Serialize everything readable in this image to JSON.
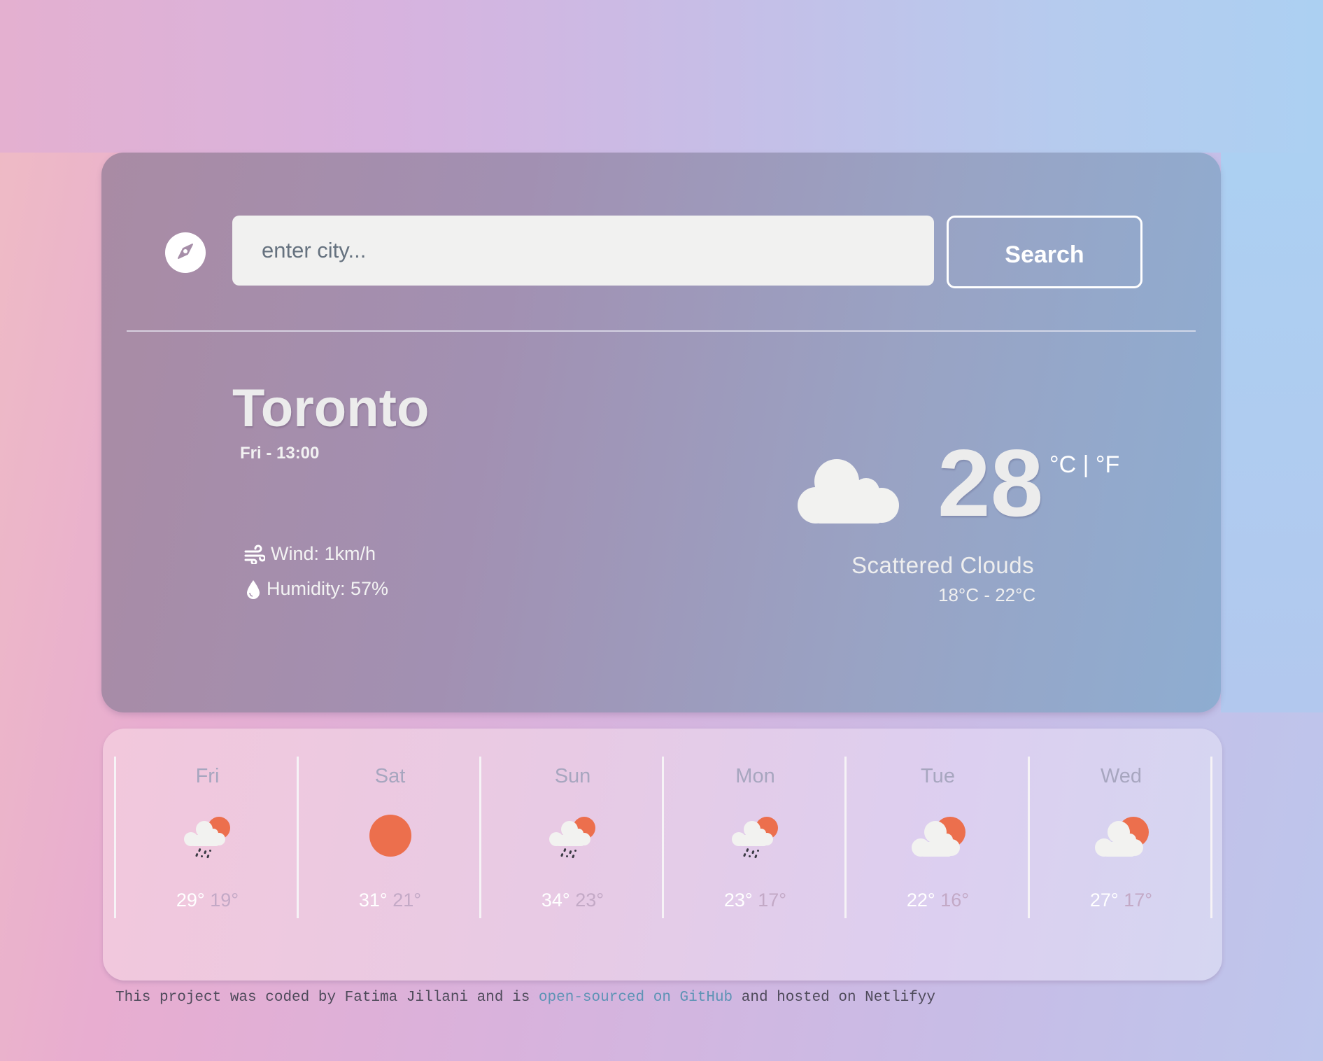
{
  "search": {
    "placeholder": "enter city...",
    "value": "",
    "button_label": "Search",
    "location_icon": "compass-icon"
  },
  "current": {
    "city": "Toronto",
    "datetime": "Fri - 13:00",
    "wind_label": "Wind: 1km/h",
    "wind_icon": "wind-icon",
    "humidity_label": "Humidity: 57%",
    "humidity_icon": "droplet-icon",
    "weather_icon": "cloud-icon",
    "temperature": "28",
    "unit_celsius": "°C",
    "unit_separator": "|",
    "unit_fahrenheit": "°F",
    "description": "Scattered Clouds",
    "range": "18°C - 22°C"
  },
  "forecast": [
    {
      "day": "Fri",
      "icon": "rain-cloud-sun-icon",
      "high": "29°",
      "low": "19°"
    },
    {
      "day": "Sat",
      "icon": "sun-icon",
      "high": "31°",
      "low": "21°"
    },
    {
      "day": "Sun",
      "icon": "rain-cloud-sun-icon",
      "high": "34°",
      "low": "23°"
    },
    {
      "day": "Mon",
      "icon": "rain-cloud-sun-icon",
      "high": "23°",
      "low": "17°"
    },
    {
      "day": "Tue",
      "icon": "cloud-sun-icon",
      "high": "22°",
      "low": "16°"
    },
    {
      "day": "Wed",
      "icon": "cloud-sun-icon",
      "high": "27°",
      "low": "17°"
    }
  ],
  "footer": {
    "text_before": "This project was coded by Fatima Jillani and is ",
    "link_text": "open-sourced on GitHub",
    "text_after": " and hosted on Netlifyy"
  },
  "colors": {
    "sun": "#ec6f4d",
    "cloud": "#f2f2f0",
    "rain": "#3a3a44",
    "link": "#5d93b5"
  }
}
